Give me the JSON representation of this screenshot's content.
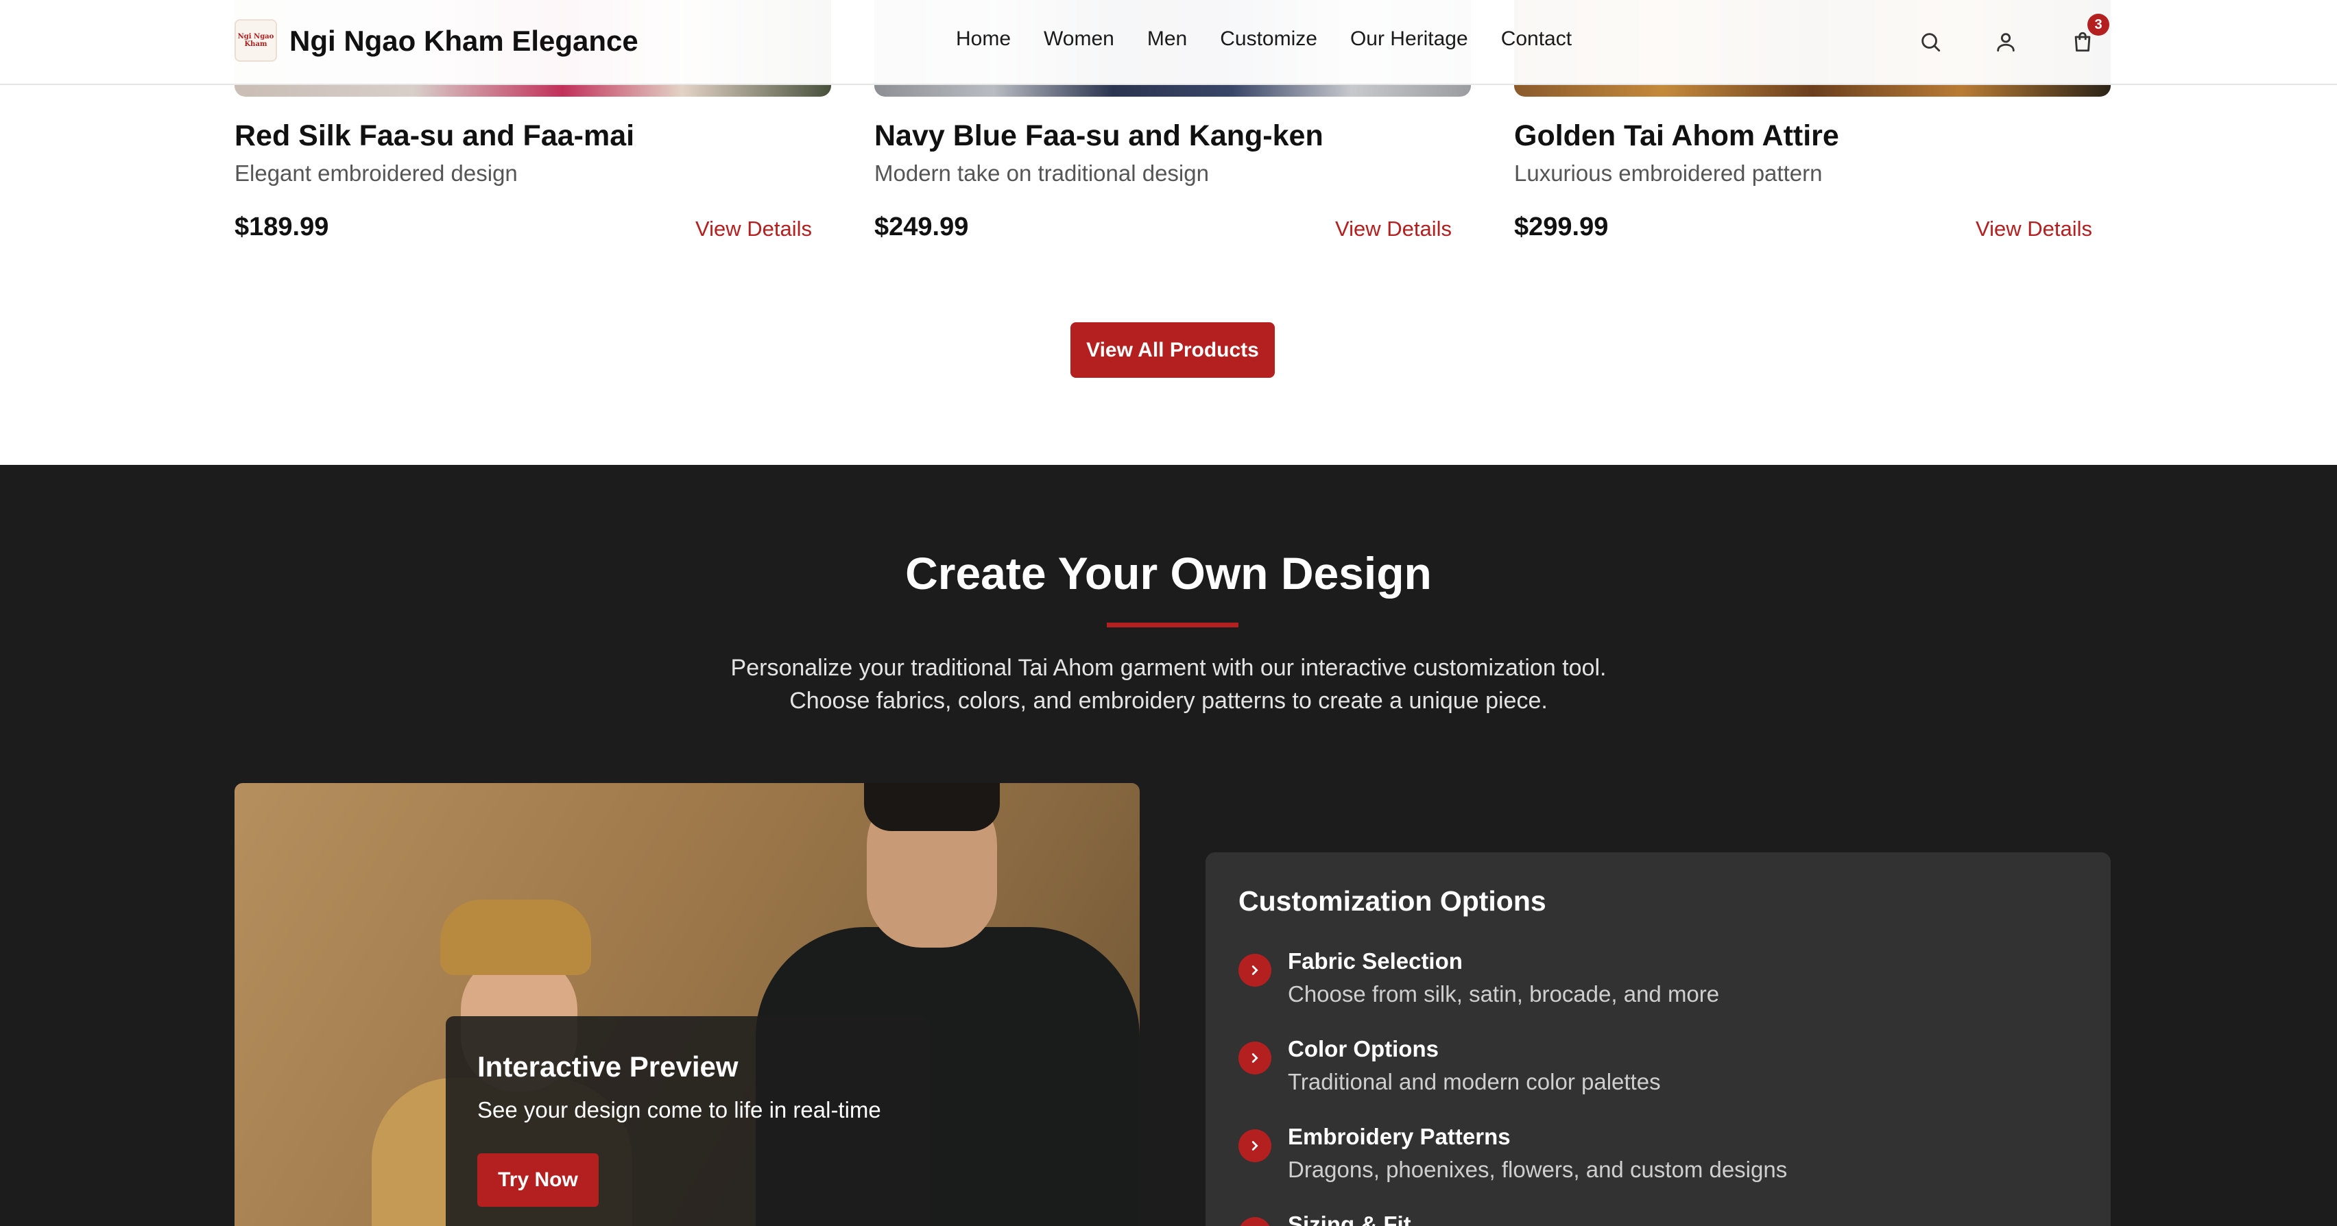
{
  "header": {
    "logo_text": [
      "Ngi Ngao",
      "Kham"
    ],
    "brand": "Ngi Ngao Kham Elegance",
    "nav": [
      "Home",
      "Women",
      "Men",
      "Customize",
      "Our Heritage",
      "Contact"
    ],
    "icons": [
      "search-icon",
      "user-icon",
      "cart-icon"
    ],
    "cart_count": "3"
  },
  "products": [
    {
      "title": "Red Silk Faa-su and Faa-mai",
      "subtitle": "Elegant embroidered design",
      "price": "$189.99",
      "link": "View Details"
    },
    {
      "title": "Navy Blue Faa-su and Kang-ken",
      "subtitle": "Modern take on traditional design",
      "price": "$249.99",
      "link": "View Details"
    },
    {
      "title": "Golden Tai Ahom Attire",
      "subtitle": "Luxurious embroidered pattern",
      "price": "$299.99",
      "link": "View Details"
    }
  ],
  "view_all_label": "View All Products",
  "customize": {
    "title": "Create Your Own Design",
    "desc_line1": "Personalize your traditional Tai Ahom garment with our interactive customization tool.",
    "desc_line2": "Choose fabrics, colors, and embroidery patterns to create a unique piece.",
    "preview": {
      "title": "Interactive Preview",
      "subtitle": "See your design come to life in real-time",
      "button": "Try Now"
    },
    "options": {
      "title": "Customization Options",
      "items": [
        {
          "title": "Fabric Selection",
          "desc": "Choose from silk, satin, brocade, and more"
        },
        {
          "title": "Color Options",
          "desc": "Traditional and modern color palettes"
        },
        {
          "title": "Embroidery Patterns",
          "desc": "Dragons, phoenixes, flowers, and custom designs"
        },
        {
          "title": "Sizing & Fit",
          "desc": ""
        }
      ]
    }
  },
  "colors": {
    "accent": "#b3201f",
    "dark_bg": "#1c1c1c",
    "panel_bg": "#323232"
  }
}
